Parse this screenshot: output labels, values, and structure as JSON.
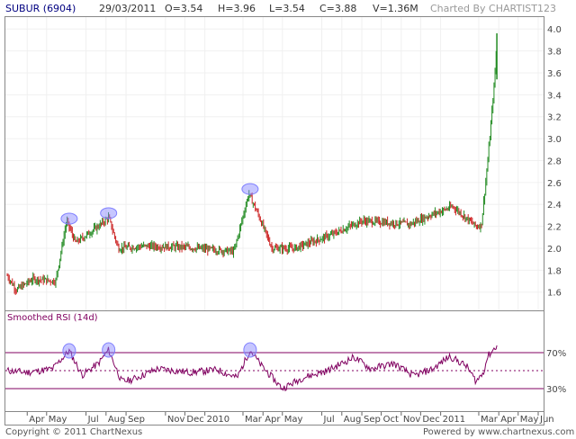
{
  "header": {
    "symbol": "SUBUR (6904)",
    "date": "29/03/2011",
    "open": "O=3.54",
    "high": "H=3.96",
    "low": "L=3.54",
    "close": "C=3.88",
    "volume": "V=1.36M",
    "credit": "Charted By CHARTIST123"
  },
  "footer": {
    "copyright": "Copyright © 2011 ChartNexus",
    "powered": "Powered by www.chartnexus.com"
  },
  "colors": {
    "up": "#228b22",
    "down": "#cc2222",
    "rsi": "#800060",
    "highlight": "#8080ff",
    "border": "#888888",
    "grid": "#f0f0f0"
  },
  "chart_data": [
    {
      "type": "candlestick",
      "title": "",
      "x_tick_labels": [
        "Apr",
        "May",
        "Jul",
        "Aug",
        "Sep",
        "Nov",
        "Dec",
        "2010",
        "Mar",
        "Apr",
        "May",
        "Jul",
        "Aug",
        "Sep",
        "Oct",
        "Nov",
        "Dec",
        "2011",
        "Mar",
        "Apr",
        "May",
        "Jun"
      ],
      "y_tick_labels": [
        "1.6",
        "1.8",
        "2.0",
        "2.2",
        "2.4",
        "2.6",
        "2.8",
        "3.0",
        "3.2",
        "3.4",
        "3.6",
        "3.8",
        "4.0"
      ],
      "ylim": [
        1.45,
        4.1
      ],
      "grid": true,
      "approx_close_path": [
        {
          "date": "2009-03-01",
          "close": 1.75
        },
        {
          "date": "2009-03-15",
          "close": 1.62
        },
        {
          "date": "2009-04-10",
          "close": 1.72
        },
        {
          "date": "2009-05-15",
          "close": 1.7
        },
        {
          "date": "2009-06-01",
          "close": 2.25
        },
        {
          "date": "2009-06-15",
          "close": 2.05
        },
        {
          "date": "2009-07-20",
          "close": 2.2
        },
        {
          "date": "2009-08-05",
          "close": 2.28
        },
        {
          "date": "2009-08-20",
          "close": 2.0
        },
        {
          "date": "2009-10-01",
          "close": 2.02
        },
        {
          "date": "2009-12-01",
          "close": 2.01
        },
        {
          "date": "2010-02-15",
          "close": 1.97
        },
        {
          "date": "2010-03-10",
          "close": 2.5
        },
        {
          "date": "2010-03-25",
          "close": 2.3
        },
        {
          "date": "2010-04-15",
          "close": 2.0
        },
        {
          "date": "2010-05-20",
          "close": 2.0
        },
        {
          "date": "2010-07-15",
          "close": 2.12
        },
        {
          "date": "2010-09-01",
          "close": 2.25
        },
        {
          "date": "2010-11-15",
          "close": 2.22
        },
        {
          "date": "2010-12-15",
          "close": 2.3
        },
        {
          "date": "2011-01-20",
          "close": 2.38
        },
        {
          "date": "2011-02-25",
          "close": 2.2
        },
        {
          "date": "2011-03-05",
          "close": 2.21
        },
        {
          "date": "2011-03-15",
          "close": 2.8
        },
        {
          "date": "2011-03-25",
          "close": 3.5
        },
        {
          "date": "2011-03-29",
          "close": 3.88
        }
      ],
      "highlights": [
        {
          "date": "2009-06-05",
          "value": 2.27
        },
        {
          "date": "2009-08-05",
          "value": 2.32
        },
        {
          "date": "2010-03-12",
          "value": 2.54
        }
      ]
    },
    {
      "type": "line",
      "title": "Smoothed RSI (14d)",
      "y_tick_labels": [
        "70%",
        "30%"
      ],
      "ylim": [
        20,
        90
      ],
      "reference_lines": [
        70,
        50,
        30
      ],
      "approx_series": [
        {
          "date": "2009-03-01",
          "rsi": 50
        },
        {
          "date": "2009-04-01",
          "rsi": 48
        },
        {
          "date": "2009-05-10",
          "rsi": 52
        },
        {
          "date": "2009-06-05",
          "rsi": 72
        },
        {
          "date": "2009-06-25",
          "rsi": 45
        },
        {
          "date": "2009-07-20",
          "rsi": 58
        },
        {
          "date": "2009-08-05",
          "rsi": 73
        },
        {
          "date": "2009-08-25",
          "rsi": 38
        },
        {
          "date": "2009-09-10",
          "rsi": 40
        },
        {
          "date": "2009-10-20",
          "rsi": 52
        },
        {
          "date": "2009-12-10",
          "rsi": 48
        },
        {
          "date": "2010-01-20",
          "rsi": 51
        },
        {
          "date": "2010-02-20",
          "rsi": 42
        },
        {
          "date": "2010-03-12",
          "rsi": 73
        },
        {
          "date": "2010-03-30",
          "rsi": 55
        },
        {
          "date": "2010-05-01",
          "rsi": 30
        },
        {
          "date": "2010-06-01",
          "rsi": 42
        },
        {
          "date": "2010-07-10",
          "rsi": 50
        },
        {
          "date": "2010-08-20",
          "rsi": 65
        },
        {
          "date": "2010-09-15",
          "rsi": 52
        },
        {
          "date": "2010-10-20",
          "rsi": 58
        },
        {
          "date": "2010-11-20",
          "rsi": 44
        },
        {
          "date": "2010-12-20",
          "rsi": 52
        },
        {
          "date": "2011-01-15",
          "rsi": 66
        },
        {
          "date": "2011-02-10",
          "rsi": 55
        },
        {
          "date": "2011-02-25",
          "rsi": 38
        },
        {
          "date": "2011-03-08",
          "rsi": 48
        },
        {
          "date": "2011-03-15",
          "rsi": 66
        },
        {
          "date": "2011-03-29",
          "rsi": 78
        }
      ],
      "highlights": [
        {
          "date": "2009-06-05",
          "rsi": 72
        },
        {
          "date": "2009-08-05",
          "rsi": 73
        },
        {
          "date": "2010-03-12",
          "rsi": 73
        }
      ]
    }
  ]
}
